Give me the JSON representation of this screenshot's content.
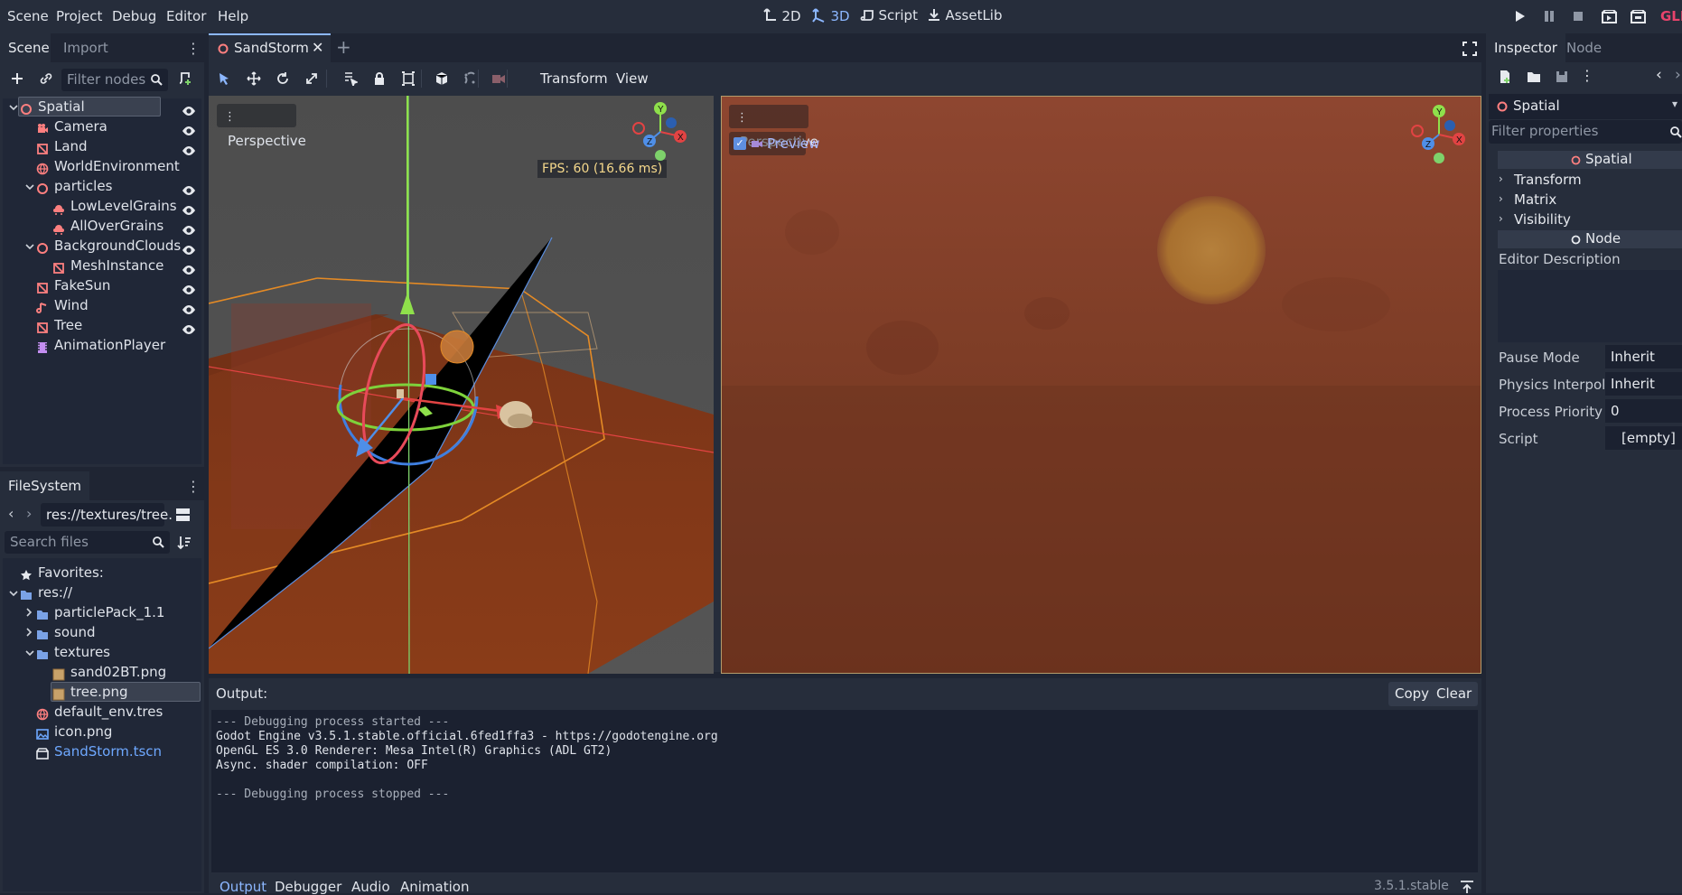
{
  "menubar": {
    "items": [
      "Scene",
      "Project",
      "Debug",
      "Editor",
      "Help"
    ],
    "workspaces": {
      "w2d": "2D",
      "w3d": "3D",
      "script": "Script",
      "assetlib": "AssetLib"
    },
    "partial_label": "GLE"
  },
  "scene_dock": {
    "tabs": {
      "scene": "Scene",
      "import": "Import"
    },
    "filter_placeholder": "Filter nodes",
    "nodes": [
      {
        "label": "Spatial",
        "icon": "spatial-icon",
        "depth": 0,
        "fold": "open",
        "color": "#fc7f7f",
        "eye": true,
        "selected": true
      },
      {
        "label": "Camera",
        "icon": "camera-icon",
        "depth": 1,
        "fold": "",
        "color": "#fc7f7f",
        "eye": true
      },
      {
        "label": "Land",
        "icon": "mesh-icon",
        "depth": 1,
        "fold": "",
        "color": "#fc7f7f",
        "eye": true
      },
      {
        "label": "WorldEnvironment",
        "icon": "environment-icon",
        "depth": 1,
        "fold": "",
        "color": "#fc7f7f",
        "eye": false
      },
      {
        "label": "particles",
        "icon": "spatial-icon",
        "depth": 1,
        "fold": "open",
        "color": "#fc7f7f",
        "eye": true
      },
      {
        "label": "LowLevelGrains",
        "icon": "particles-icon",
        "depth": 2,
        "fold": "",
        "color": "#fc7f7f",
        "eye": true
      },
      {
        "label": "AllOverGrains",
        "icon": "particles-icon",
        "depth": 2,
        "fold": "",
        "color": "#fc7f7f",
        "eye": true
      },
      {
        "label": "BackgroundClouds",
        "icon": "spatial-icon",
        "depth": 1,
        "fold": "open",
        "color": "#fc7f7f",
        "eye": true
      },
      {
        "label": "MeshInstance",
        "icon": "mesh-icon",
        "depth": 2,
        "fold": "",
        "color": "#fc7f7f",
        "eye": true
      },
      {
        "label": "FakeSun",
        "icon": "mesh-icon",
        "depth": 1,
        "fold": "",
        "color": "#fc7f7f",
        "eye": true
      },
      {
        "label": "Wind",
        "icon": "audio-icon",
        "depth": 1,
        "fold": "",
        "color": "#fc7f7f",
        "eye": true
      },
      {
        "label": "Tree",
        "icon": "mesh-icon",
        "depth": 1,
        "fold": "",
        "color": "#fc7f7f",
        "eye": true
      },
      {
        "label": "AnimationPlayer",
        "icon": "animation-player-icon",
        "depth": 1,
        "fold": "",
        "color": "#c38ef1",
        "eye": false
      }
    ]
  },
  "filesystem": {
    "tab": "FileSystem",
    "path": "res://textures/tree.",
    "search_placeholder": "Search files",
    "items": [
      {
        "label": "Favorites:",
        "icon": "star-icon",
        "depth": 0,
        "fold": ""
      },
      {
        "label": "res://",
        "icon": "folder-icon",
        "depth": 0,
        "fold": "open"
      },
      {
        "label": "particlePack_1.1",
        "icon": "folder-icon",
        "depth": 1,
        "fold": "closed"
      },
      {
        "label": "sound",
        "icon": "folder-icon",
        "depth": 1,
        "fold": "closed"
      },
      {
        "label": "textures",
        "icon": "folder-icon",
        "depth": 1,
        "fold": "open"
      },
      {
        "label": "sand02BT.png",
        "icon": "texture-thumb-icon",
        "depth": 2,
        "fold": ""
      },
      {
        "label": "tree.png",
        "icon": "texture-thumb-icon",
        "depth": 2,
        "fold": "",
        "selected": true
      },
      {
        "label": "default_env.tres",
        "icon": "environment-icon",
        "depth": 1,
        "fold": ""
      },
      {
        "label": "icon.png",
        "icon": "image-icon",
        "depth": 1,
        "fold": ""
      },
      {
        "label": "SandStorm.tscn",
        "icon": "scene-file-icon",
        "depth": 1,
        "fold": "",
        "highlight": true
      }
    ]
  },
  "editor": {
    "scene_tab": "SandStorm",
    "toolbar": {
      "transform": "Transform",
      "view": "View"
    },
    "left_view": {
      "perspective": "Perspective",
      "fps": "FPS: 60 (16.66 ms)"
    },
    "right_view": {
      "perspective": "Perspective",
      "preview": "Preview"
    },
    "gizmo": {
      "x": "X",
      "y": "Y",
      "z": "Z"
    }
  },
  "output": {
    "title": "Output:",
    "copy": "Copy",
    "clear": "Clear",
    "lines": [
      {
        "text": "--- Debugging process started ---",
        "dim": true
      },
      {
        "text": "Godot Engine v3.5.1.stable.official.6fed1ffa3 - https://godotengine.org",
        "dim": false
      },
      {
        "text": "OpenGL ES 3.0 Renderer: Mesa Intel(R) Graphics (ADL GT2)",
        "dim": false
      },
      {
        "text": "Async. shader compilation: OFF",
        "dim": false
      },
      {
        "text": "",
        "dim": false
      },
      {
        "text": "--- Debugging process stopped ---",
        "dim": true
      }
    ],
    "bottom_tabs": [
      "Output",
      "Debugger",
      "Audio",
      "Animation"
    ],
    "version": "3.5.1.stable"
  },
  "inspector": {
    "tabs": {
      "inspector": "Inspector",
      "node": "Node"
    },
    "object": "Spatial",
    "filter_placeholder": "Filter properties",
    "section_spatial": "Spatial",
    "groups": [
      "Transform",
      "Matrix",
      "Visibility"
    ],
    "section_node": "Node",
    "editor_description": "Editor Description",
    "properties": [
      {
        "label": "Pause Mode",
        "value": "Inherit"
      },
      {
        "label": "Physics Interpol",
        "value": "Inherit"
      },
      {
        "label": "Process Priority",
        "value": "0"
      },
      {
        "label": "Script",
        "value": "[empty]"
      }
    ]
  },
  "colors": {
    "accent": "#8cb7ff",
    "node_red": "#fc7f7f",
    "scene_link": "#6ea8ff",
    "fps": "#f5d88b"
  }
}
